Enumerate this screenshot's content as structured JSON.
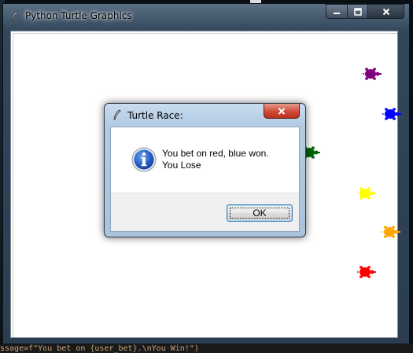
{
  "window": {
    "title": "Python Turtle Graphics",
    "controls": [
      "minimize",
      "maximize",
      "close"
    ]
  },
  "turtles": [
    {
      "color": "purple",
      "hex": "#800080"
    },
    {
      "color": "blue",
      "hex": "#0000ff"
    },
    {
      "color": "green",
      "hex": "#006400"
    },
    {
      "color": "yellow",
      "hex": "#ffff00"
    },
    {
      "color": "orange",
      "hex": "#ffa500"
    },
    {
      "color": "red",
      "hex": "#ff0000"
    }
  ],
  "dialog": {
    "title": "Turtle Race:",
    "message": "You bet on red, blue won.\nYou Lose",
    "ok_label": "OK",
    "icon": "info-icon"
  },
  "background": {
    "code_snippet": "ssage=f\"You bet on {user_bet}.\\nYou Win!\")"
  }
}
